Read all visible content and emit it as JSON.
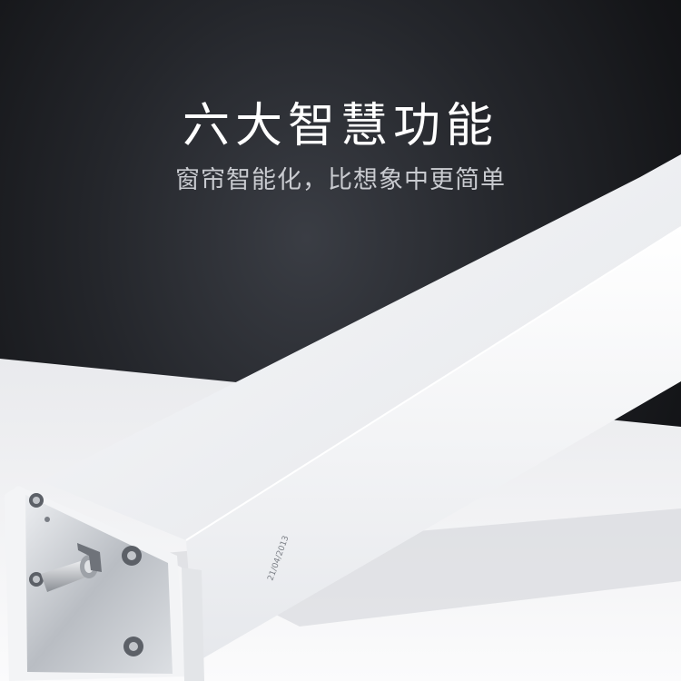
{
  "banner": {
    "headline": "六大智慧功能",
    "subheadline": "窗帘智能化，比想象中更简单"
  },
  "product": {
    "label_text": "21/04/2013",
    "colors": {
      "background": "#1a1b1e",
      "track_body": "#f4f5f7",
      "end_cap": "#c8cbd0",
      "light_floor": "#f2f3f5"
    }
  }
}
